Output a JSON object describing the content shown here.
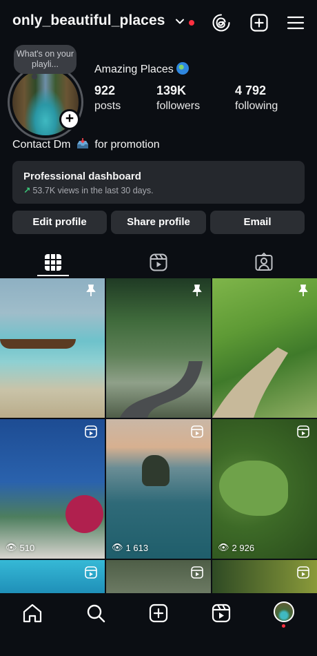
{
  "header": {
    "username": "only_beautiful_places"
  },
  "profile": {
    "note": "What's on your playli...",
    "display_name": "Amazing Places",
    "stats": [
      {
        "value": "922",
        "label": "posts"
      },
      {
        "value": "139K",
        "label": "followers"
      },
      {
        "value": "4 792",
        "label": "following"
      }
    ],
    "bio_before": "Contact Dm",
    "bio_after": "for promotion"
  },
  "dashboard": {
    "title": "Professional dashboard",
    "subtitle": "53.7K views in the last 30 days."
  },
  "buttons": {
    "edit": "Edit profile",
    "share": "Share profile",
    "email": "Email"
  },
  "grid": {
    "views": [
      "510",
      "1 613",
      "2 926"
    ]
  },
  "colors": {
    "background": "#0b0e13",
    "card": "#25282d",
    "button": "#2b2e33",
    "accent_red": "#ff3040",
    "trend_green": "#3cc77b"
  },
  "icons": {
    "top": [
      "chevron-down-icon",
      "threads-icon",
      "new-post-icon",
      "menu-icon"
    ],
    "tabs": [
      "grid-icon",
      "reels-icon",
      "tagged-icon"
    ],
    "nav": [
      "home-icon",
      "search-icon",
      "create-icon",
      "reels-icon",
      "profile-avatar"
    ]
  }
}
